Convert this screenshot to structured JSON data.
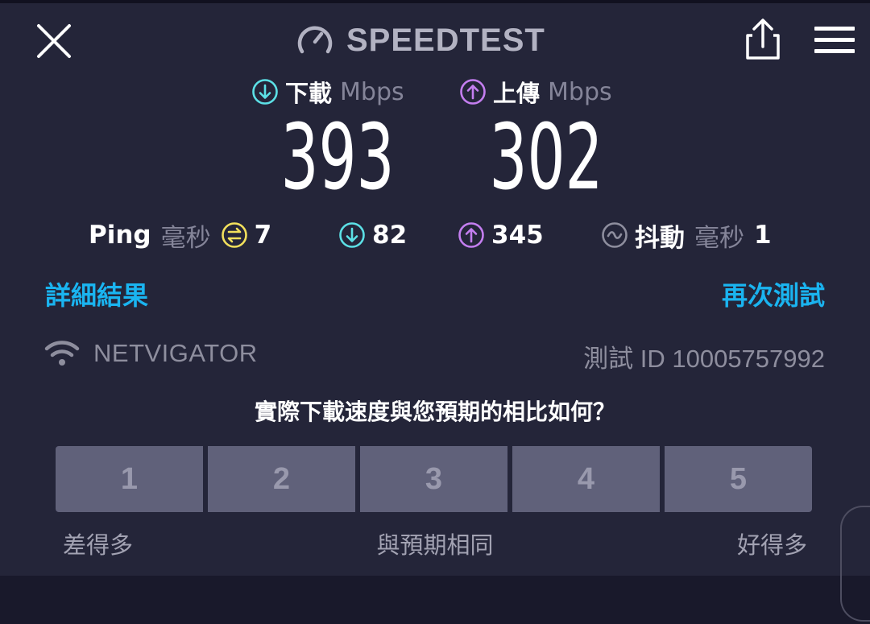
{
  "header": {
    "title": "SPEEDTEST",
    "icons": {
      "close": "close-icon",
      "logo": "speedometer-icon",
      "share": "share-icon",
      "menu": "hamburger-menu-icon"
    }
  },
  "download": {
    "label": "下載",
    "unit": "Mbps",
    "value": "393",
    "icon": "download-arrow-icon",
    "color": "#5ce0e6"
  },
  "upload": {
    "label": "上傳",
    "unit": "Mbps",
    "value": "302",
    "icon": "upload-arrow-icon",
    "color": "#c47ef0"
  },
  "stats": {
    "ping_label": "Ping",
    "ping_unit": "毫秒",
    "ping_idle": "7",
    "ping_download": "82",
    "ping_upload": "345",
    "jitter_label": "抖動",
    "jitter_unit": "毫秒",
    "jitter_value": "1",
    "ping_color": "#f2e05c"
  },
  "links": {
    "detail": "詳細結果",
    "retest": "再次測試",
    "color": "#1ab4f0"
  },
  "connection": {
    "isp": "NETVIGATOR",
    "test_id": "測試 ID 10005757992",
    "icon": "wifi-icon"
  },
  "survey": {
    "question": "實際下載速度與您預期的相比如何？",
    "ratings": [
      "1",
      "2",
      "3",
      "4",
      "5"
    ],
    "scale_low": "差得多",
    "scale_mid": "與預期相同",
    "scale_high": "好得多"
  },
  "colors": {
    "background": "#242539",
    "bottom_bar": "#19192b",
    "rating_button": "#60617a"
  }
}
